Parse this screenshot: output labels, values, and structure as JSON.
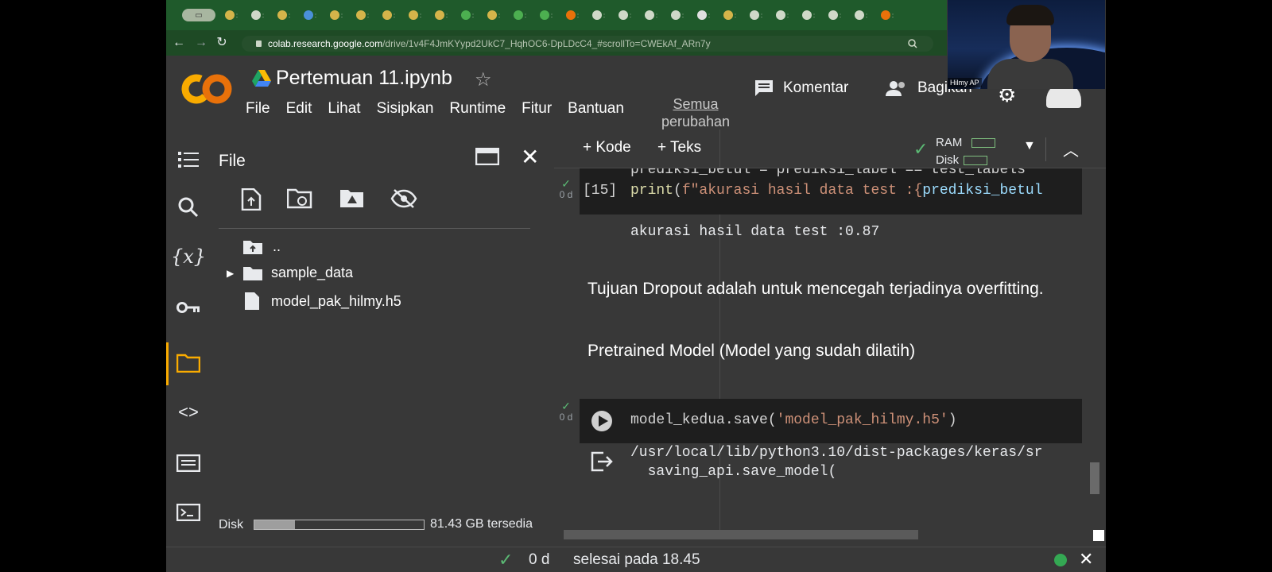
{
  "browser": {
    "url_host": "colab.research.google.com",
    "url_path": "/drive/1v4F4JmKYypd2UkC7_HqhOC6-DpLDcC4_#scrollTo=CWEkAf_ARn7y",
    "tabs": [
      "tab-1",
      "tab-2",
      "tab-3",
      "tab-4",
      "tab-5",
      "tab-6",
      "tab-7",
      "tab-8",
      "tab-9",
      "tab-10",
      "tab-11",
      "tab-12",
      "tab-13",
      "tab-14",
      "tab-15",
      "tab-16",
      "tab-17",
      "tab-18",
      "tab-19",
      "tab-20",
      "tab-21",
      "tab-22",
      "tab-23",
      "tab-24",
      "tab-25",
      "tab-26"
    ]
  },
  "webcam": {
    "name": "Hilmy AP"
  },
  "header": {
    "logo": "CO",
    "title": "Pertemuan 11.ipynb",
    "menu": [
      "File",
      "Edit",
      "Lihat",
      "Sisipkan",
      "Runtime",
      "Fitur",
      "Bantuan"
    ],
    "changes_line1": "Semua",
    "changes_line2": "perubahan",
    "comment_label": "Komentar",
    "share_label": "Bagikan"
  },
  "file_panel": {
    "title": "File",
    "parent": "..",
    "items": [
      {
        "name": "sample_data",
        "type": "folder"
      },
      {
        "name": "model_pak_hilmy.h5",
        "type": "file"
      }
    ],
    "disk_label": "Disk",
    "disk_used_fraction": 0.24,
    "disk_free": "81.43 GB tersedia"
  },
  "toolbar": {
    "add_code": "+ Kode",
    "add_text": "+ Teks",
    "ram": "RAM",
    "disk": "Disk"
  },
  "cells": {
    "cell1_count": "[15]",
    "cell1_exec": "0 d",
    "cell1_line1": "prediksi_betul = prediksi_label == test_labels",
    "cell1_line2_fn": "print",
    "cell1_line2_str": "f\"akurasi hasil data test :{",
    "cell1_line2_rest": "prediksi_betul",
    "cell1_output": "akurasi hasil data test :0.87",
    "text1": "Tujuan Dropout adalah untuk mencegah terjadinya overfitting.",
    "text2": "Pretrained Model (Model yang sudah dilatih)",
    "cell2_exec": "0 d",
    "cell2_code_obj": "model_kedua.save(",
    "cell2_code_str": "'model_pak_hilmy.h5'",
    "cell2_code_end": ")",
    "cell2_out1": "/usr/local/lib/python3.10/dist-packages/keras/sr",
    "cell2_out2": "  saving_api.save_model("
  },
  "status": {
    "time": "0 d",
    "text": "selesai pada 18.45"
  },
  "colors": {
    "accent": "#f9ab00",
    "ok": "#5bb974",
    "tabbar": "#1f5a2b",
    "bg": "#383838"
  }
}
